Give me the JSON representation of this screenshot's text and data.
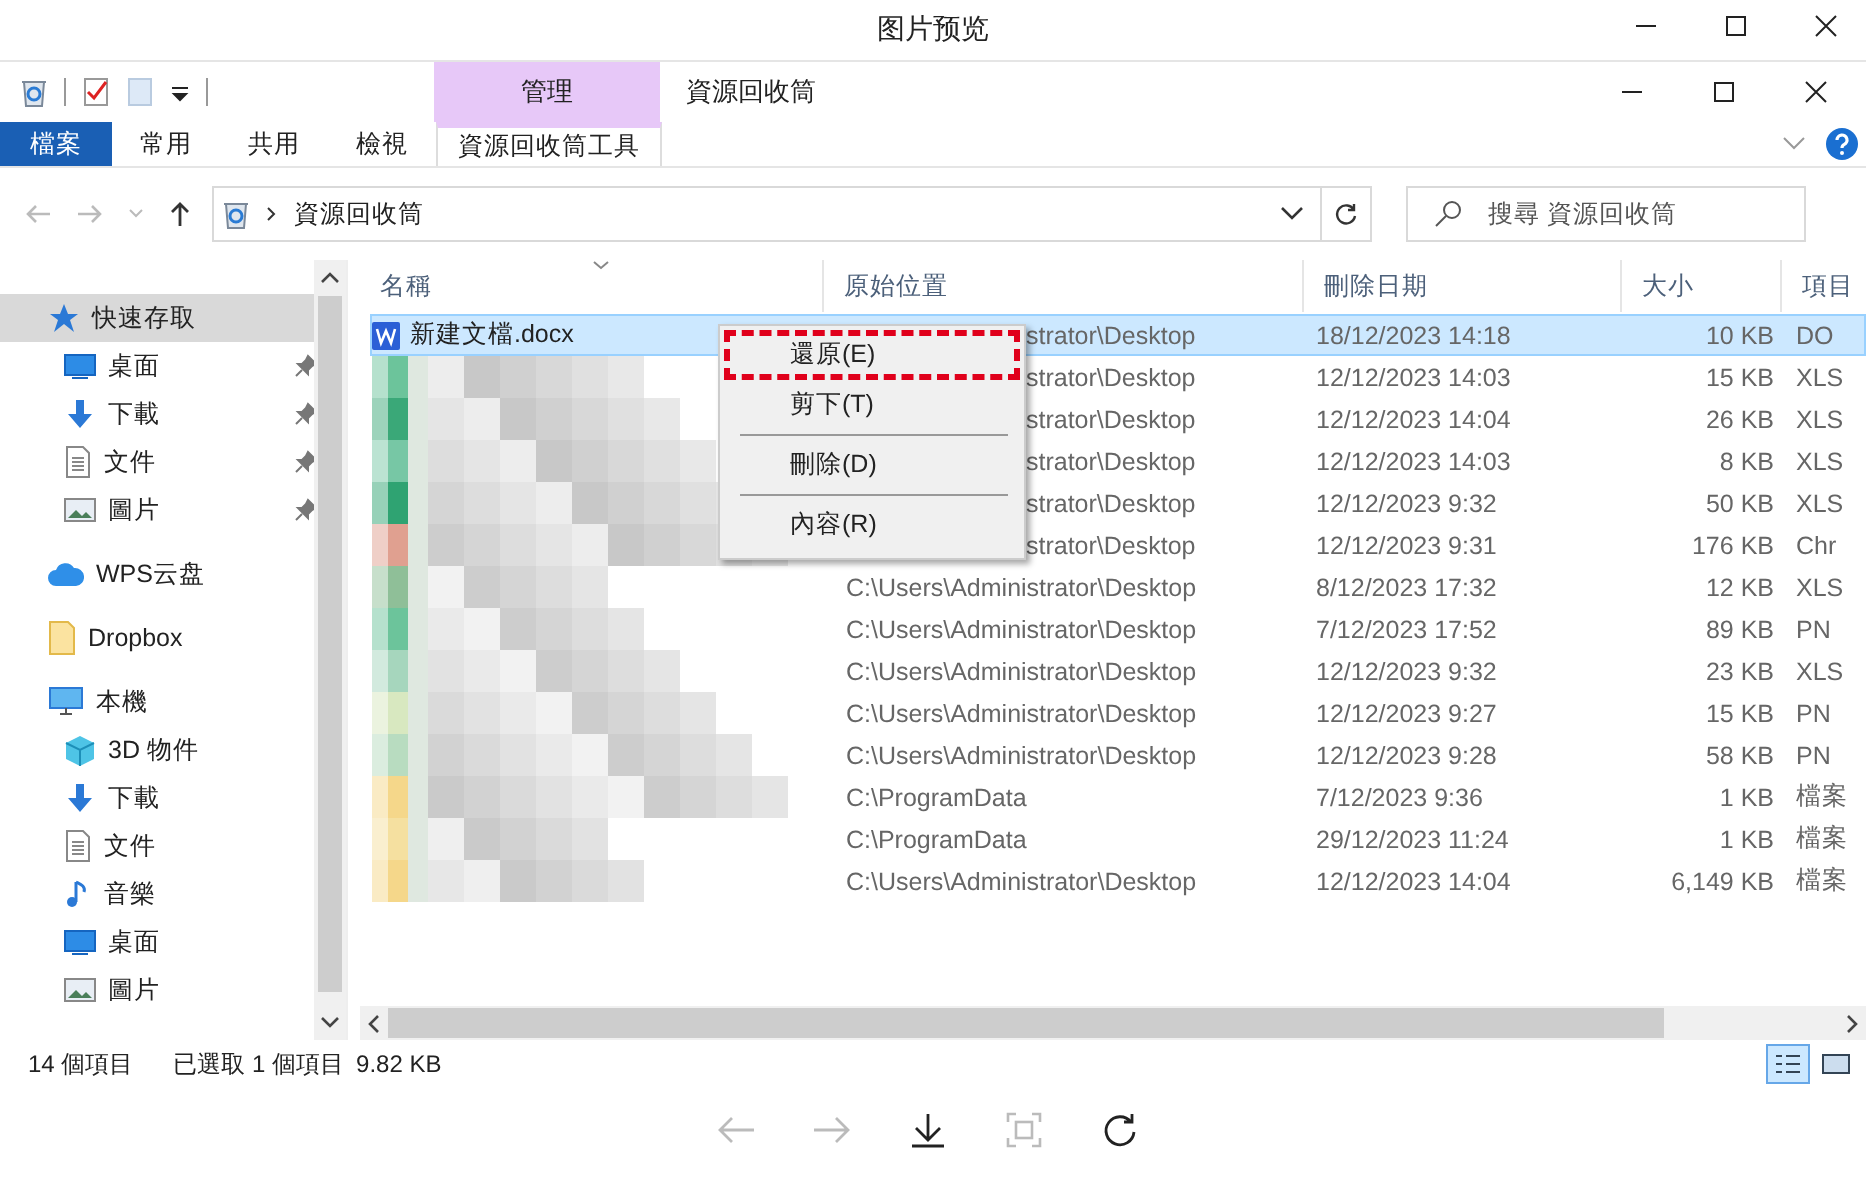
{
  "viewer": {
    "title": "图片预览"
  },
  "explorer": {
    "contextual_group": "管理",
    "title": "資源回收筒",
    "ribbon_tabs": [
      {
        "label": "檔案",
        "kind": "file",
        "selected": false
      },
      {
        "label": "常用",
        "kind": "tab",
        "selected": false
      },
      {
        "label": "共用",
        "kind": "tab",
        "selected": false
      },
      {
        "label": "檢視",
        "kind": "tab",
        "selected": false
      },
      {
        "label": "資源回收筒工具",
        "kind": "contextual",
        "selected": true
      }
    ],
    "address": {
      "path": "資源回收筒"
    },
    "search": {
      "placeholder": "搜尋 資源回收筒"
    },
    "sidebar": [
      {
        "label": "快速存取",
        "selected": true,
        "children": [
          {
            "label": "桌面",
            "pinned": true
          },
          {
            "label": "下載",
            "pinned": true
          },
          {
            "label": "文件",
            "pinned": true
          },
          {
            "label": "圖片",
            "pinned": true
          }
        ]
      },
      {
        "label": "WPS云盘",
        "selected": false
      },
      {
        "label": "Dropbox",
        "selected": false
      },
      {
        "label": "本機",
        "selected": false,
        "children": [
          {
            "label": "3D 物件",
            "pinned": false
          },
          {
            "label": "下載",
            "pinned": false
          },
          {
            "label": "文件",
            "pinned": false
          },
          {
            "label": "音樂",
            "pinned": false
          },
          {
            "label": "桌面",
            "pinned": false
          },
          {
            "label": "圖片",
            "pinned": false
          }
        ]
      }
    ],
    "columns": [
      {
        "label": "名稱",
        "sorted": true
      },
      {
        "label": "原始位置",
        "sorted": false
      },
      {
        "label": "刪除日期",
        "sorted": false
      },
      {
        "label": "大小",
        "sorted": false
      },
      {
        "label": "項目",
        "sorted": false
      }
    ],
    "rows": [
      {
        "name": "新建文檔.docx",
        "location": "strator\\Desktop",
        "location_clipped": true,
        "deleted": "18/12/2023 14:18",
        "size": "10 KB",
        "type": "DO",
        "selected": true
      },
      {
        "location": "strator\\Desktop",
        "location_clipped": true,
        "deleted": "12/12/2023 14:03",
        "size": "15 KB",
        "type": "XLS",
        "selected": false
      },
      {
        "location": "strator\\Desktop",
        "location_clipped": true,
        "deleted": "12/12/2023 14:04",
        "size": "26 KB",
        "type": "XLS",
        "selected": false
      },
      {
        "location": "strator\\Desktop",
        "location_clipped": true,
        "deleted": "12/12/2023 14:03",
        "size": "8 KB",
        "type": "XLS",
        "selected": false
      },
      {
        "location": "strator\\Desktop",
        "location_clipped": true,
        "deleted": "12/12/2023 9:32",
        "size": "50 KB",
        "type": "XLS",
        "selected": false
      },
      {
        "location": "strator\\Desktop",
        "location_clipped": true,
        "deleted": "12/12/2023 9:31",
        "size": "176 KB",
        "type": "Chr",
        "selected": false
      },
      {
        "location": "C:\\Users\\Administrator\\Desktop",
        "location_clipped": false,
        "deleted": "8/12/2023 17:32",
        "size": "12 KB",
        "type": "XLS",
        "selected": false
      },
      {
        "location": "C:\\Users\\Administrator\\Desktop",
        "location_clipped": false,
        "deleted": "7/12/2023 17:52",
        "size": "89 KB",
        "type": "PN",
        "selected": false
      },
      {
        "location": "C:\\Users\\Administrator\\Desktop",
        "location_clipped": false,
        "deleted": "12/12/2023 9:32",
        "size": "23 KB",
        "type": "XLS",
        "selected": false
      },
      {
        "location": "C:\\Users\\Administrator\\Desktop",
        "location_clipped": false,
        "deleted": "12/12/2023 9:27",
        "size": "15 KB",
        "type": "PN",
        "selected": false
      },
      {
        "location": "C:\\Users\\Administrator\\Desktop",
        "location_clipped": false,
        "deleted": "12/12/2023 9:28",
        "size": "58 KB",
        "type": "PN",
        "selected": false
      },
      {
        "location": "C:\\ProgramData",
        "location_clipped": false,
        "deleted": "7/12/2023 9:36",
        "size": "1 KB",
        "type": "檔案",
        "selected": false
      },
      {
        "location": "C:\\ProgramData",
        "location_clipped": false,
        "deleted": "29/12/2023 11:24",
        "size": "1 KB",
        "type": "檔案",
        "selected": false
      },
      {
        "location": "C:\\Users\\Administrator\\Desktop",
        "location_clipped": false,
        "deleted": "12/12/2023 14:04",
        "size": "6,149 KB",
        "type": "檔案",
        "selected": false
      }
    ],
    "context_menu": [
      {
        "kind": "item",
        "label": "還原(E)",
        "highlighted": true
      },
      {
        "kind": "item",
        "label": "剪下(T)",
        "highlighted": false
      },
      {
        "kind": "separator"
      },
      {
        "kind": "item",
        "label": "刪除(D)",
        "highlighted": false
      },
      {
        "kind": "separator"
      },
      {
        "kind": "item",
        "label": "內容(R)",
        "highlighted": false
      }
    ],
    "status_bar": {
      "count": "14 個項目",
      "selection": "已選取 1 個項目",
      "selection_size": "9.82 KB"
    },
    "view_buttons": [
      {
        "selected": true
      },
      {
        "selected": false
      }
    ]
  },
  "viewer_toolbar": [
    {
      "disabled": true
    },
    {
      "disabled": true
    },
    {
      "disabled": false
    },
    {
      "disabled": true
    },
    {
      "disabled": false
    }
  ]
}
